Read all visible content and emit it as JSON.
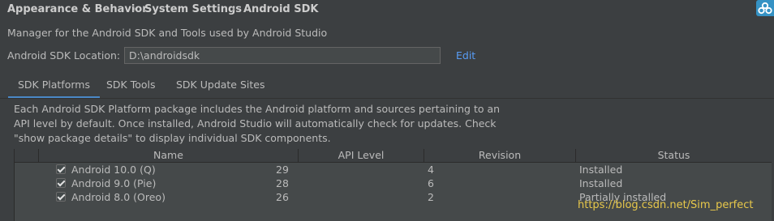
{
  "breadcrumb": {
    "items": [
      "Appearance & Behavior",
      "System Settings",
      "Android SDK"
    ],
    "separator": "›"
  },
  "description": "Manager for the Android SDK and Tools used by Android Studio",
  "sdk_location": {
    "label": "Android SDK Location:",
    "value": "D:\\androidsdk",
    "edit_label": "Edit"
  },
  "tabs": [
    {
      "label": "SDK Platforms",
      "active": true
    },
    {
      "label": "SDK Tools",
      "active": false
    },
    {
      "label": "SDK Update Sites",
      "active": false
    }
  ],
  "info_text": "Each Android SDK Platform package includes the Android platform and sources pertaining to an API level by default. Once installed, Android Studio will automatically check for updates. Check \"show package details\" to display individual SDK components.",
  "table": {
    "columns": [
      "Name",
      "API Level",
      "Revision",
      "Status"
    ],
    "rows": [
      {
        "checked": true,
        "name": "Android 10.0 (Q)",
        "api_level": "29",
        "revision": "4",
        "status": "Installed"
      },
      {
        "checked": true,
        "name": "Android 9.0 (Pie)",
        "api_level": "28",
        "revision": "6",
        "status": "Installed"
      },
      {
        "checked": true,
        "name": "Android 8.0 (Oreo)",
        "api_level": "26",
        "revision": "2",
        "status": "Partially installed"
      }
    ]
  },
  "watermark": "https://blog.csdn.net/Sim_perfect",
  "colors": {
    "background": "#3c3f41",
    "link": "#589df6",
    "tab_underline": "#4a88c7",
    "watermark": "#e8c84a"
  }
}
